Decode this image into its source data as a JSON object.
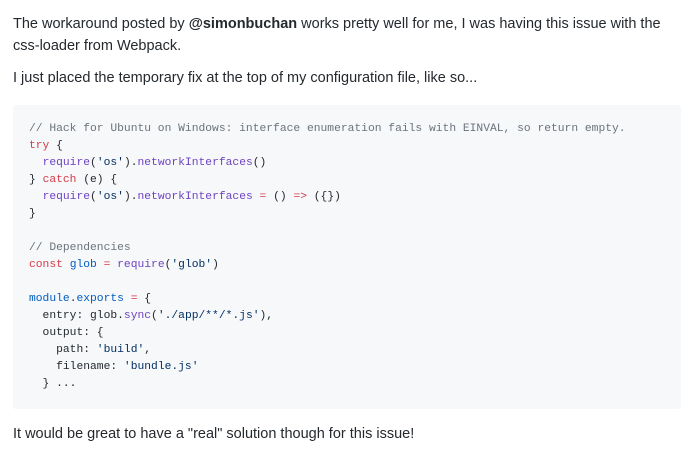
{
  "comment": {
    "para1": {
      "before": "The workaround posted by ",
      "mention": "@simonbuchan",
      "after": " works pretty well for me, I was having this issue with the css-loader from Webpack."
    },
    "para2": "I just placed the temporary fix at the top of my configuration file, like so...",
    "code": {
      "lines": [
        [
          {
            "t": "// Hack for Ubuntu on Windows: interface enumeration fails with EINVAL, so return empty.",
            "c": "comment"
          }
        ],
        [
          {
            "t": "try",
            "c": "keyword"
          },
          {
            "t": " {",
            "c": "plain"
          }
        ],
        [
          {
            "t": "  ",
            "c": "plain"
          },
          {
            "t": "require",
            "c": "func"
          },
          {
            "t": "(",
            "c": "plain"
          },
          {
            "t": "'os'",
            "c": "string"
          },
          {
            "t": ").",
            "c": "plain"
          },
          {
            "t": "networkInterfaces",
            "c": "func"
          },
          {
            "t": "()",
            "c": "plain"
          }
        ],
        [
          {
            "t": "} ",
            "c": "plain"
          },
          {
            "t": "catch",
            "c": "keyword"
          },
          {
            "t": " (e) {",
            "c": "plain"
          }
        ],
        [
          {
            "t": "  ",
            "c": "plain"
          },
          {
            "t": "require",
            "c": "func"
          },
          {
            "t": "(",
            "c": "plain"
          },
          {
            "t": "'os'",
            "c": "string"
          },
          {
            "t": ").",
            "c": "plain"
          },
          {
            "t": "networkInterfaces",
            "c": "func"
          },
          {
            "t": " ",
            "c": "plain"
          },
          {
            "t": "=",
            "c": "keyword"
          },
          {
            "t": " () ",
            "c": "plain"
          },
          {
            "t": "=>",
            "c": "keyword"
          },
          {
            "t": " ({})",
            "c": "plain"
          }
        ],
        [
          {
            "t": "}",
            "c": "plain"
          }
        ],
        [],
        [
          {
            "t": "// Dependencies",
            "c": "comment"
          }
        ],
        [
          {
            "t": "const",
            "c": "keyword"
          },
          {
            "t": " ",
            "c": "plain"
          },
          {
            "t": "glob",
            "c": "const"
          },
          {
            "t": " ",
            "c": "plain"
          },
          {
            "t": "=",
            "c": "keyword"
          },
          {
            "t": " ",
            "c": "plain"
          },
          {
            "t": "require",
            "c": "func"
          },
          {
            "t": "(",
            "c": "plain"
          },
          {
            "t": "'glob'",
            "c": "string"
          },
          {
            "t": ")",
            "c": "plain"
          }
        ],
        [],
        [
          {
            "t": "module",
            "c": "const"
          },
          {
            "t": ".",
            "c": "plain"
          },
          {
            "t": "exports",
            "c": "const"
          },
          {
            "t": " ",
            "c": "plain"
          },
          {
            "t": "=",
            "c": "keyword"
          },
          {
            "t": " {",
            "c": "plain"
          }
        ],
        [
          {
            "t": "  entry: ",
            "c": "plain"
          },
          {
            "t": "glob",
            "c": "plain"
          },
          {
            "t": ".",
            "c": "plain"
          },
          {
            "t": "sync",
            "c": "func"
          },
          {
            "t": "(",
            "c": "plain"
          },
          {
            "t": "'./app/**/*.js'",
            "c": "string"
          },
          {
            "t": "),",
            "c": "plain"
          }
        ],
        [
          {
            "t": "  output: {",
            "c": "plain"
          }
        ],
        [
          {
            "t": "    path: ",
            "c": "plain"
          },
          {
            "t": "'build'",
            "c": "string"
          },
          {
            "t": ",",
            "c": "plain"
          }
        ],
        [
          {
            "t": "    filename: ",
            "c": "plain"
          },
          {
            "t": "'bundle.js'",
            "c": "string"
          }
        ],
        [
          {
            "t": "  } ...",
            "c": "plain"
          }
        ]
      ]
    },
    "para3": "It would be great to have a \"real\" solution though for this issue!"
  },
  "colors": {
    "text": "#24292e",
    "code_bg": "#f6f8fa",
    "comment": "#6a737d",
    "keyword": "#d73a49",
    "function": "#6f42c1",
    "string": "#032f62",
    "constant": "#005cc5"
  }
}
